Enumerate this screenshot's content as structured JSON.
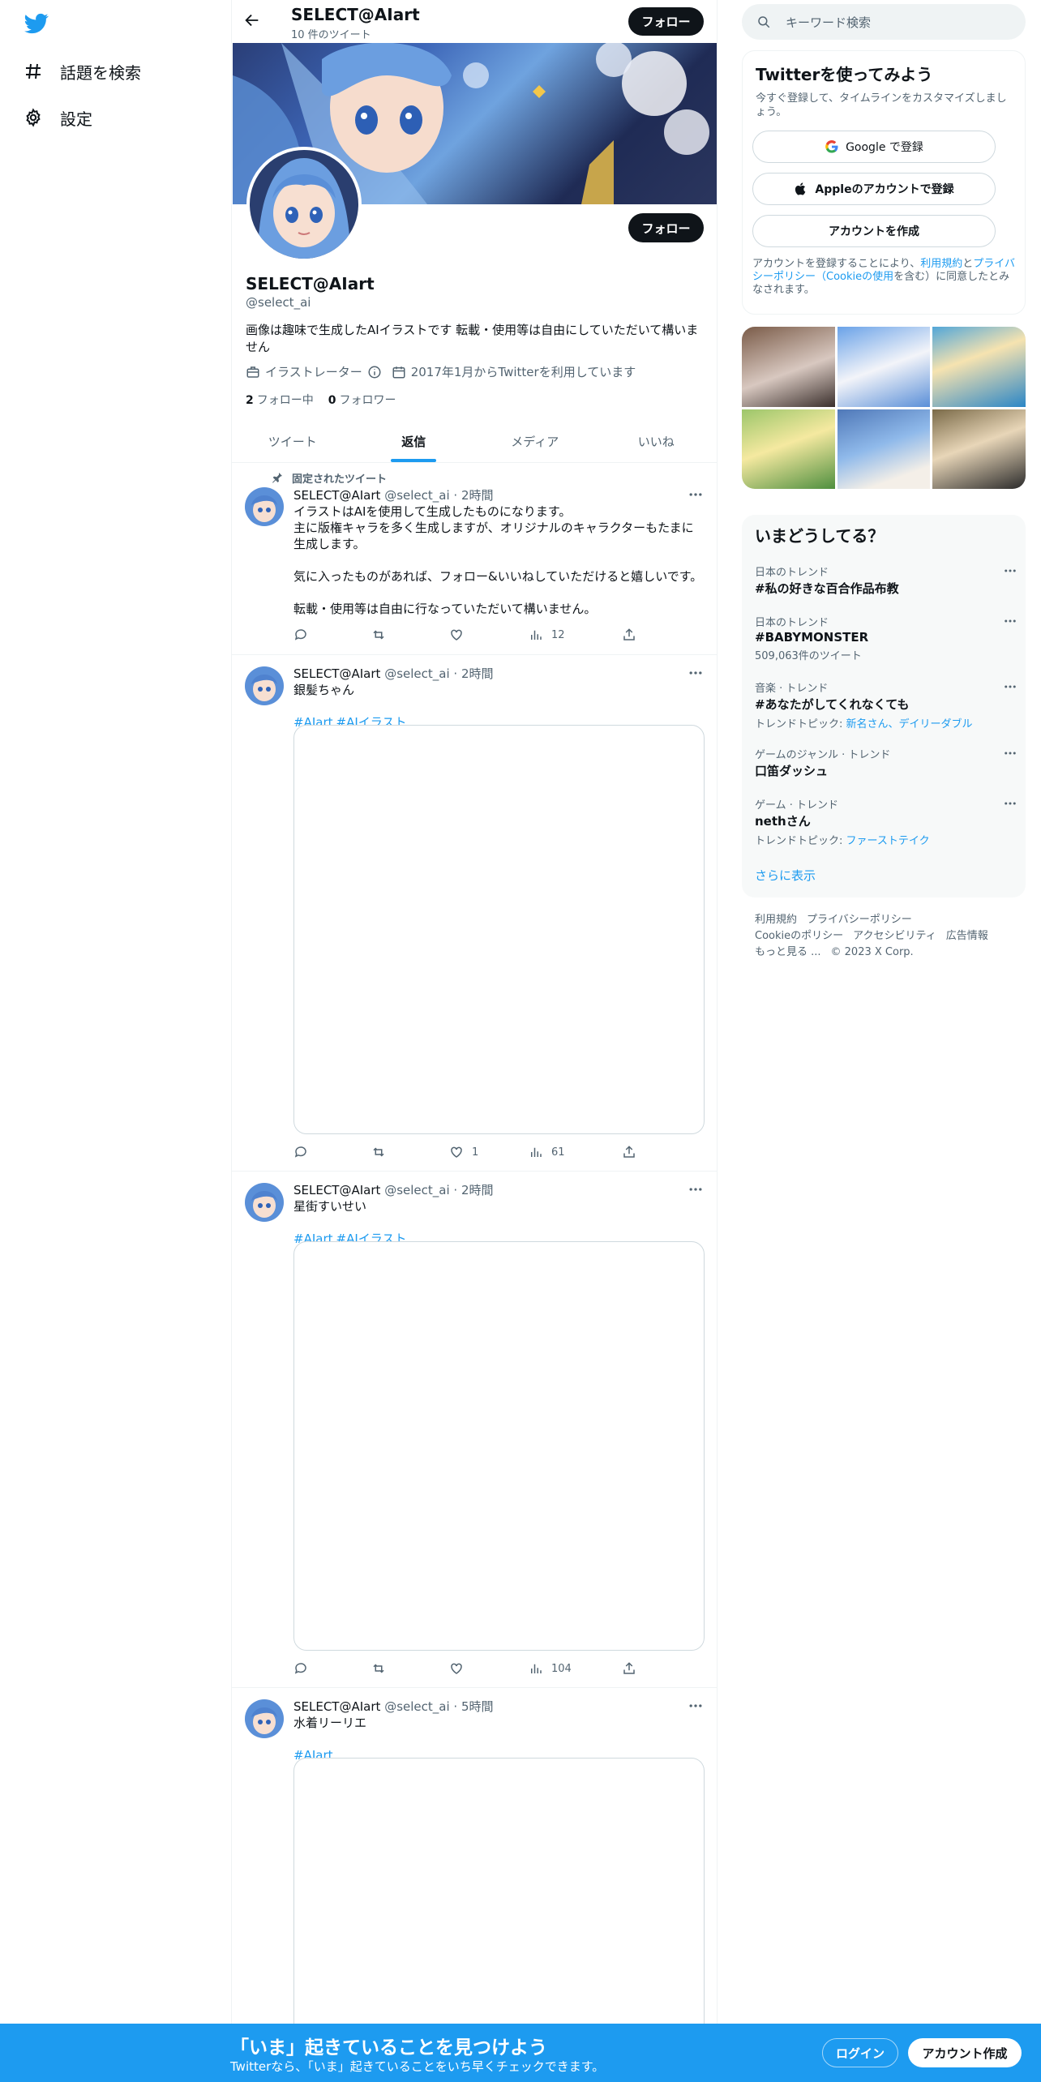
{
  "nav": {
    "explore_label": "話題を検索",
    "settings_label": "設定"
  },
  "profile": {
    "display_name": "SELECT@AIart",
    "tweet_count": "10 件のツイート",
    "follow_label": "フォロー",
    "handle": "@select_ai",
    "bio": "画像は趣味で生成したAIイラストです 転載・使用等は自由にしていただいて構いません",
    "category": "イラストレーター",
    "joined": "2017年1月からTwitterを利用しています",
    "following_count": "2",
    "following_label": "フォロー中",
    "followers_count": "0",
    "followers_label": "フォロワー"
  },
  "tabs": [
    {
      "label": "ツイート"
    },
    {
      "label": "返信"
    },
    {
      "label": "メディア"
    },
    {
      "label": "いいね"
    }
  ],
  "active_tab": "返信",
  "pinned_label": "固定されたツイート",
  "tweets": [
    {
      "name": "SELECT@AIart",
      "handle": "@select_ai",
      "time": "2時間",
      "text": "イラストはAIを使用して生成したものになります。\n主に版権キャラを多く生成しますが、オリジナルのキャラクターもたまに生成します。\n\n気に入ったものがあれば、フォロー&いいねしていただけると嬉しいです。\n\n転載・使用等は自由に行なっていただいて構いません。",
      "hashtags": [],
      "replies": "",
      "retweets": "",
      "likes": "",
      "views": "12"
    },
    {
      "name": "SELECT@AIart",
      "handle": "@select_ai",
      "time": "2時間",
      "text": "銀髪ちゃん",
      "hashtags": [
        "#AIart",
        "#AIイラスト"
      ],
      "replies": "",
      "retweets": "",
      "likes": "1",
      "views": "61"
    },
    {
      "name": "SELECT@AIart",
      "handle": "@select_ai",
      "time": "2時間",
      "text": "星街すいせい",
      "hashtags": [
        "#AIart",
        "#AIイラスト"
      ],
      "replies": "",
      "retweets": "",
      "likes": "",
      "views": "104"
    },
    {
      "name": "SELECT@AIart",
      "handle": "@select_ai",
      "time": "5時間",
      "text": "水着リーリエ",
      "hashtags": [
        "#AIart"
      ],
      "replies": "",
      "retweets": "",
      "likes": "",
      "views": ""
    }
  ],
  "search": {
    "placeholder": "キーワード検索"
  },
  "signup": {
    "title": "Twitterを使ってみよう",
    "subtitle": "今すぐ登録して、タイムラインをカスタマイズしましょう。",
    "google_label": "Google で登録",
    "apple_label": "Appleのアカウントで登録",
    "create_label": "アカウントを作成",
    "terms_1": "アカウントを登録することにより、",
    "terms_link_1": "利用規約",
    "terms_2": "と",
    "terms_link_2": "プライバシーポリシー（Cookieの使用",
    "terms_3": "を含む）に同意したとみなされます。"
  },
  "trends": {
    "title": "いまどうしてる？",
    "items": [
      {
        "context": "日本のトレンド",
        "name": "#私の好きな百合作品布教",
        "sub_prefix": "",
        "sub": ""
      },
      {
        "context": "日本のトレンド",
        "name": "#BABYMONSTER",
        "sub_prefix": "509,063件のツイート",
        "sub": ""
      },
      {
        "context": "音楽 · トレンド",
        "name": "#あなたがしてくれなくても",
        "sub_prefix": "トレンドトピック: ",
        "sub": "新名さん、デイリーダブル"
      },
      {
        "context": "ゲームのジャンル · トレンド",
        "name": "口笛ダッシュ",
        "sub_prefix": "",
        "sub": ""
      },
      {
        "context": "ゲーム · トレンド",
        "name": "nethさん",
        "sub_prefix": "トレンドトピック: ",
        "sub": "ファーストテイク"
      }
    ],
    "show_more": "さらに表示"
  },
  "footer": {
    "terms": "利用規約",
    "privacy": "プライバシーポリシー",
    "cookie": "Cookieのポリシー",
    "accessibility": "アクセシビリティ",
    "ads": "広告情報",
    "more": "もっと見る ...",
    "copyright": "© 2023 X Corp."
  },
  "bottom_bar": {
    "title": "「いま」起きていることを見つけよう",
    "subtitle": "Twitterなら、「いま」起きていることをいち早くチェックできます。",
    "login_label": "ログイン",
    "signup_label": "アカウント作成"
  },
  "colors": {
    "brand": "#1d9bf0",
    "text": "#0f1419",
    "muted": "#536471"
  }
}
